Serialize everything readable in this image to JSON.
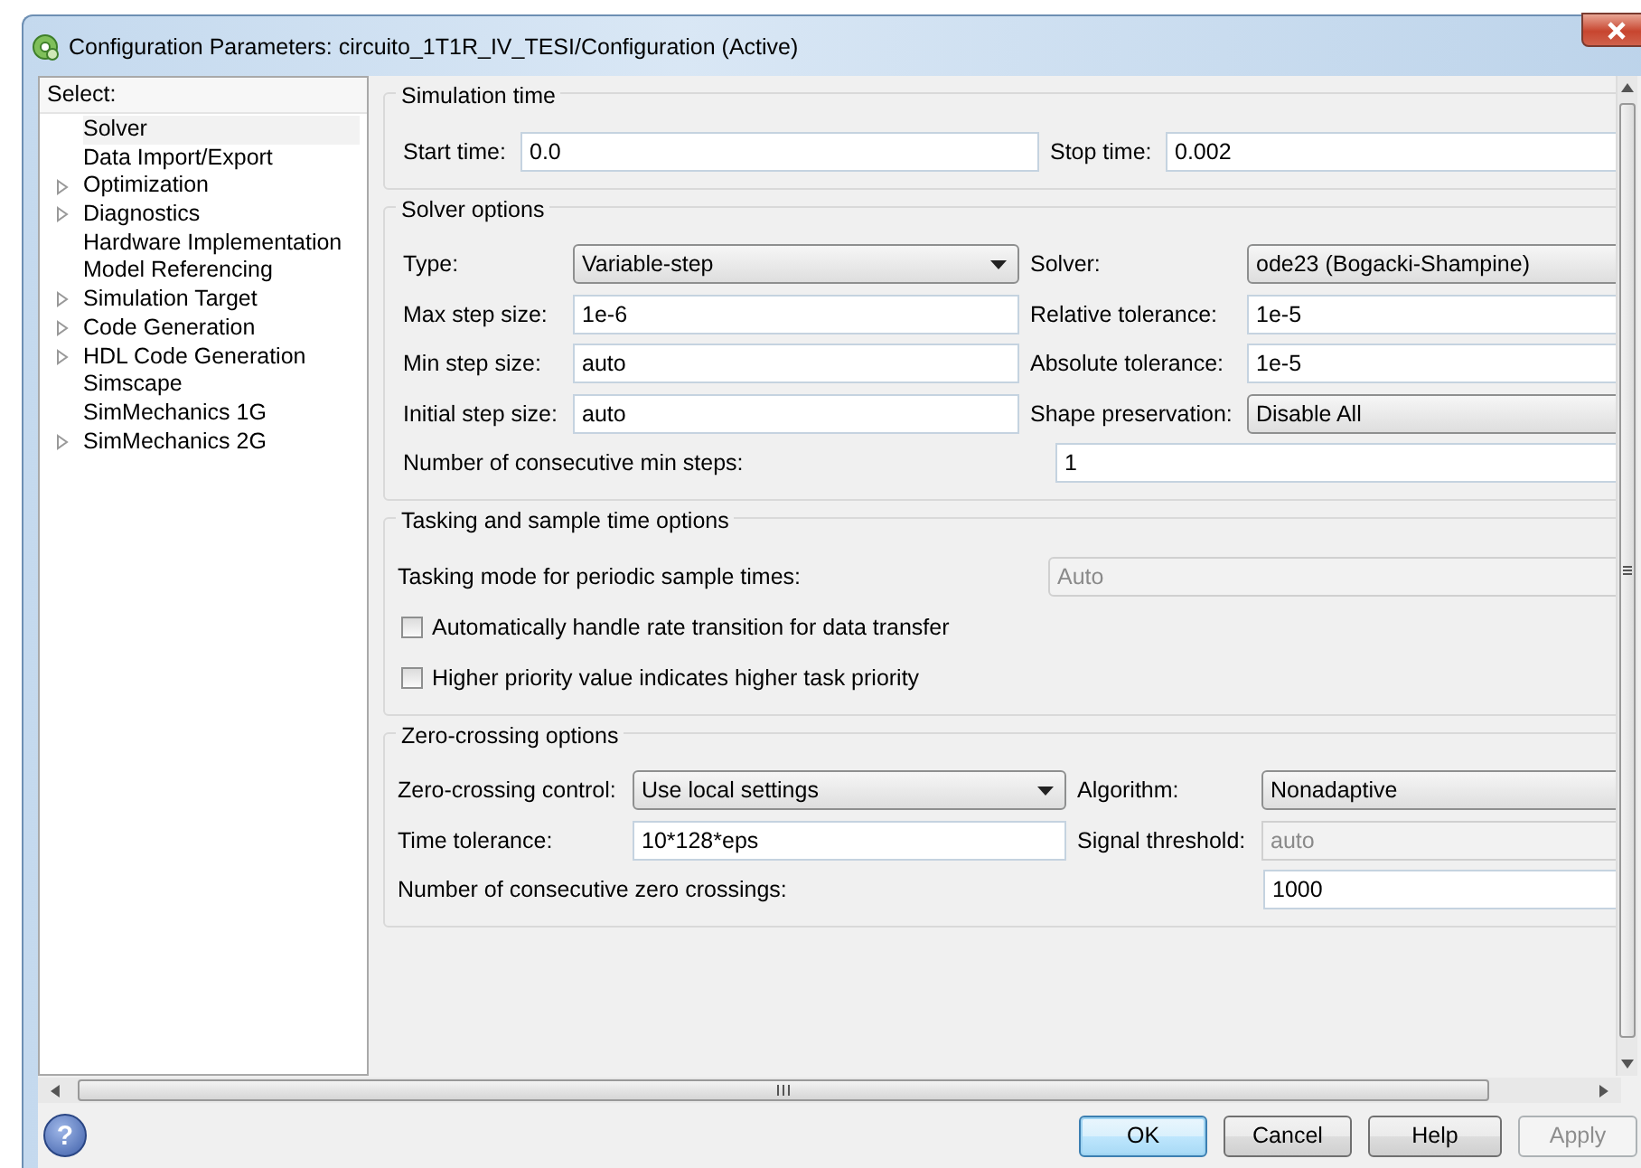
{
  "window": {
    "title": "Configuration Parameters: circuito_1T1R_IV_TESI/Configuration (Active)"
  },
  "sidebar": {
    "header": "Select:",
    "items": [
      {
        "label": "Solver",
        "expandable": false,
        "selected": true
      },
      {
        "label": "Data Import/Export",
        "expandable": false,
        "selected": false
      },
      {
        "label": "Optimization",
        "expandable": true,
        "selected": false
      },
      {
        "label": "Diagnostics",
        "expandable": true,
        "selected": false
      },
      {
        "label": "Hardware Implementation",
        "expandable": false,
        "selected": false
      },
      {
        "label": "Model Referencing",
        "expandable": false,
        "selected": false
      },
      {
        "label": "Simulation Target",
        "expandable": true,
        "selected": false
      },
      {
        "label": "Code Generation",
        "expandable": true,
        "selected": false
      },
      {
        "label": "HDL Code Generation",
        "expandable": true,
        "selected": false
      },
      {
        "label": "Simscape",
        "expandable": false,
        "selected": false
      },
      {
        "label": "SimMechanics 1G",
        "expandable": false,
        "selected": false
      },
      {
        "label": "SimMechanics 2G",
        "expandable": true,
        "selected": false
      }
    ]
  },
  "sections": [
    {
      "title": "Simulation time",
      "rows": [
        {
          "kind": "fields",
          "cells": [
            {
              "label": "Start time:",
              "value": "0.0",
              "kind": "text",
              "disabled": false
            },
            {
              "label": "Stop time:",
              "value": "0.002",
              "kind": "text",
              "disabled": false
            }
          ]
        }
      ]
    },
    {
      "title": "Solver options",
      "rows": [
        {
          "kind": "fields",
          "cells": [
            {
              "label": "Type:",
              "value": "Variable-step",
              "kind": "dropdown",
              "disabled": false
            },
            {
              "label": "Solver:",
              "value": "ode23 (Bogacki-Shampine)",
              "kind": "dropdown",
              "disabled": false
            }
          ]
        },
        {
          "kind": "fields",
          "cells": [
            {
              "label": "Max step size:",
              "value": "1e-6",
              "kind": "text",
              "disabled": false
            },
            {
              "label": "Relative tolerance:",
              "value": "1e-5",
              "kind": "text",
              "disabled": false
            }
          ]
        },
        {
          "kind": "fields",
          "cells": [
            {
              "label": "Min step size:",
              "value": "auto",
              "kind": "text",
              "disabled": false
            },
            {
              "label": "Absolute tolerance:",
              "value": "1e-5",
              "kind": "text",
              "disabled": false
            }
          ]
        },
        {
          "kind": "fields",
          "cells": [
            {
              "label": "Initial step size:",
              "value": "auto",
              "kind": "text",
              "disabled": false
            },
            {
              "label": "Shape preservation:",
              "value": "Disable All",
              "kind": "dropdown",
              "disabled": false
            }
          ]
        },
        {
          "kind": "wide",
          "cells": [
            {
              "label": "Number of consecutive min steps:",
              "value": "1",
              "kind": "text",
              "disabled": false
            }
          ]
        }
      ]
    },
    {
      "title": "Tasking and sample time options",
      "rows": [
        {
          "kind": "wide",
          "cells": [
            {
              "label": "Tasking mode for periodic sample times:",
              "value": "Auto",
              "kind": "dropdown",
              "disabled": true
            }
          ]
        },
        {
          "kind": "checkbox",
          "label": "Automatically handle rate transition for data transfer",
          "checked": false
        },
        {
          "kind": "checkbox",
          "label": "Higher priority value indicates higher task priority",
          "checked": false
        }
      ]
    },
    {
      "title": "Zero-crossing options",
      "rows": [
        {
          "kind": "fields",
          "cells": [
            {
              "label": "Zero-crossing control:",
              "value": "Use local settings",
              "kind": "dropdown",
              "disabled": false
            },
            {
              "label": "Algorithm:",
              "value": "Nonadaptive",
              "kind": "dropdown",
              "disabled": false
            }
          ]
        },
        {
          "kind": "fields",
          "cells": [
            {
              "label": "Time tolerance:",
              "value": "10*128*eps",
              "kind": "text",
              "disabled": false
            },
            {
              "label": "Signal threshold:",
              "value": "auto",
              "kind": "text",
              "disabled": true
            }
          ]
        },
        {
          "kind": "wide",
          "cells": [
            {
              "label": "Number of consecutive zero crossings:",
              "value": "1000",
              "kind": "text",
              "disabled": false
            }
          ]
        }
      ]
    }
  ],
  "help": {
    "glyph": "?"
  },
  "buttons": [
    {
      "label": "OK",
      "default": true,
      "disabled": false
    },
    {
      "label": "Cancel",
      "default": false,
      "disabled": false
    },
    {
      "label": "Help",
      "default": false,
      "disabled": false
    },
    {
      "label": "Apply",
      "default": false,
      "disabled": true
    }
  ]
}
